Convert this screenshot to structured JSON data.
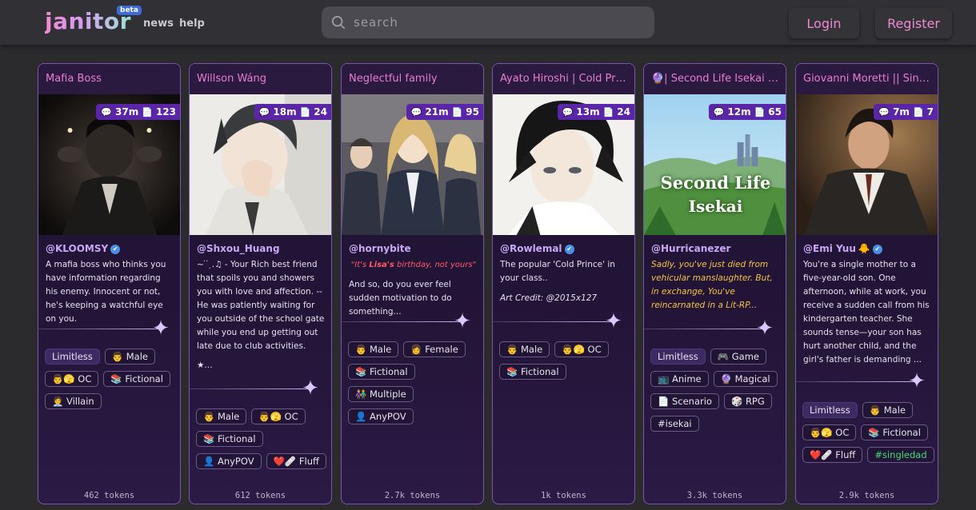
{
  "header": {
    "logo": "janitor",
    "beta": "beta",
    "nav": [
      "news",
      "help"
    ],
    "search_placeholder": "search",
    "login": "Login",
    "register": "Register"
  },
  "colors": {
    "accent": "#e97cd2",
    "card_border": "#7a55b0",
    "stat_badge": "#5b25a8",
    "tag_green": "#3fdc6b"
  },
  "cards": [
    {
      "title": "Mafia Boss",
      "chats": "37m",
      "messages": "123",
      "creator": "@KLOOMSY",
      "creator_badge": "verified-icon",
      "description": "A mafia boss who thinks you have information regarding his enemy. Innocent or not, he's keeping a watchful eye on you.",
      "tags": [
        "Limitless",
        "👨 Male",
        "👨🫣 OC",
        "📚 Fictional",
        "🧑‍💼 Villain"
      ],
      "tokens": "462 tokens"
    },
    {
      "title": "Willson Wáng",
      "chats": "18m",
      "messages": "24",
      "creator": "@Shxou_Huang",
      "description": "~ ̇ ̇ ̣.♫ - Your Rich best friend that spoils you and showers you with love and affection. -- He was patiently waiting for you outside of the school gate while you end up getting out late due to club activities.",
      "description_extra": "★...",
      "tags": [
        "👨 Male",
        "👨🫣 OC",
        "📚 Fictional",
        "👤 AnyPOV",
        "❤️🩹 Fluff"
      ],
      "tokens": "612 tokens"
    },
    {
      "title": "Neglectful family",
      "chats": "21m",
      "messages": "95",
      "creator": "@hornybite",
      "description_highlight_pre": "\"It's ",
      "description_highlight_name": "Lisa's",
      "description_highlight_post": " birthday, not yours\"",
      "description": "And so, do you ever feel sudden motivation to do something...",
      "tags": [
        "👨 Male",
        "👩 Female",
        "📚 Fictional",
        "👫 Multiple",
        "👤 AnyPOV"
      ],
      "tokens": "2.7k tokens"
    },
    {
      "title": "Ayato Hiroshi | Cold Prince",
      "chats": "13m",
      "messages": "24",
      "creator": "@Rowlemal",
      "creator_badge": "verified-icon",
      "description": "The popular 'Cold Prince' in your class..",
      "description_extra": "Art Credit: @2015x127",
      "tags": [
        "👨 Male",
        "👨🫣 OC",
        "📚 Fictional"
      ],
      "tokens": "1k tokens"
    },
    {
      "title": "🔮| Second Life Isekai RPG",
      "chats": "12m",
      "messages": "65",
      "creator": "@Hurricanezer",
      "description": "Sadly, you've just died from vehicular manslaughter. But, in exchange, You've reincarnated in a Lit-RP...",
      "image_text_1": "Second Life",
      "image_text_2": "Isekai",
      "tags": [
        "Limitless",
        "🎮 Game",
        "📺 Anime",
        "🔮 Magical",
        "📄 Scenario",
        "🎲 RPG",
        "#isekai"
      ],
      "tokens": "3.3k tokens"
    },
    {
      "title": "Giovanni Moretti || Single Father",
      "chats": "7m",
      "messages": "7",
      "creator": "@Emi Yuu",
      "description": "You're a single mother to a five-year-old son. One afternoon, while at work, you receive a sudden call from his kindergarten teacher. She sounds tense—your son has hurt another child, and the girl's father is demanding ...",
      "tags": [
        "Limitless",
        "👨 Male",
        "👨🫣 OC",
        "📚 Fictional",
        "❤️🩹 Fluff",
        "#singledad"
      ],
      "tokens": "2.9k tokens"
    }
  ]
}
